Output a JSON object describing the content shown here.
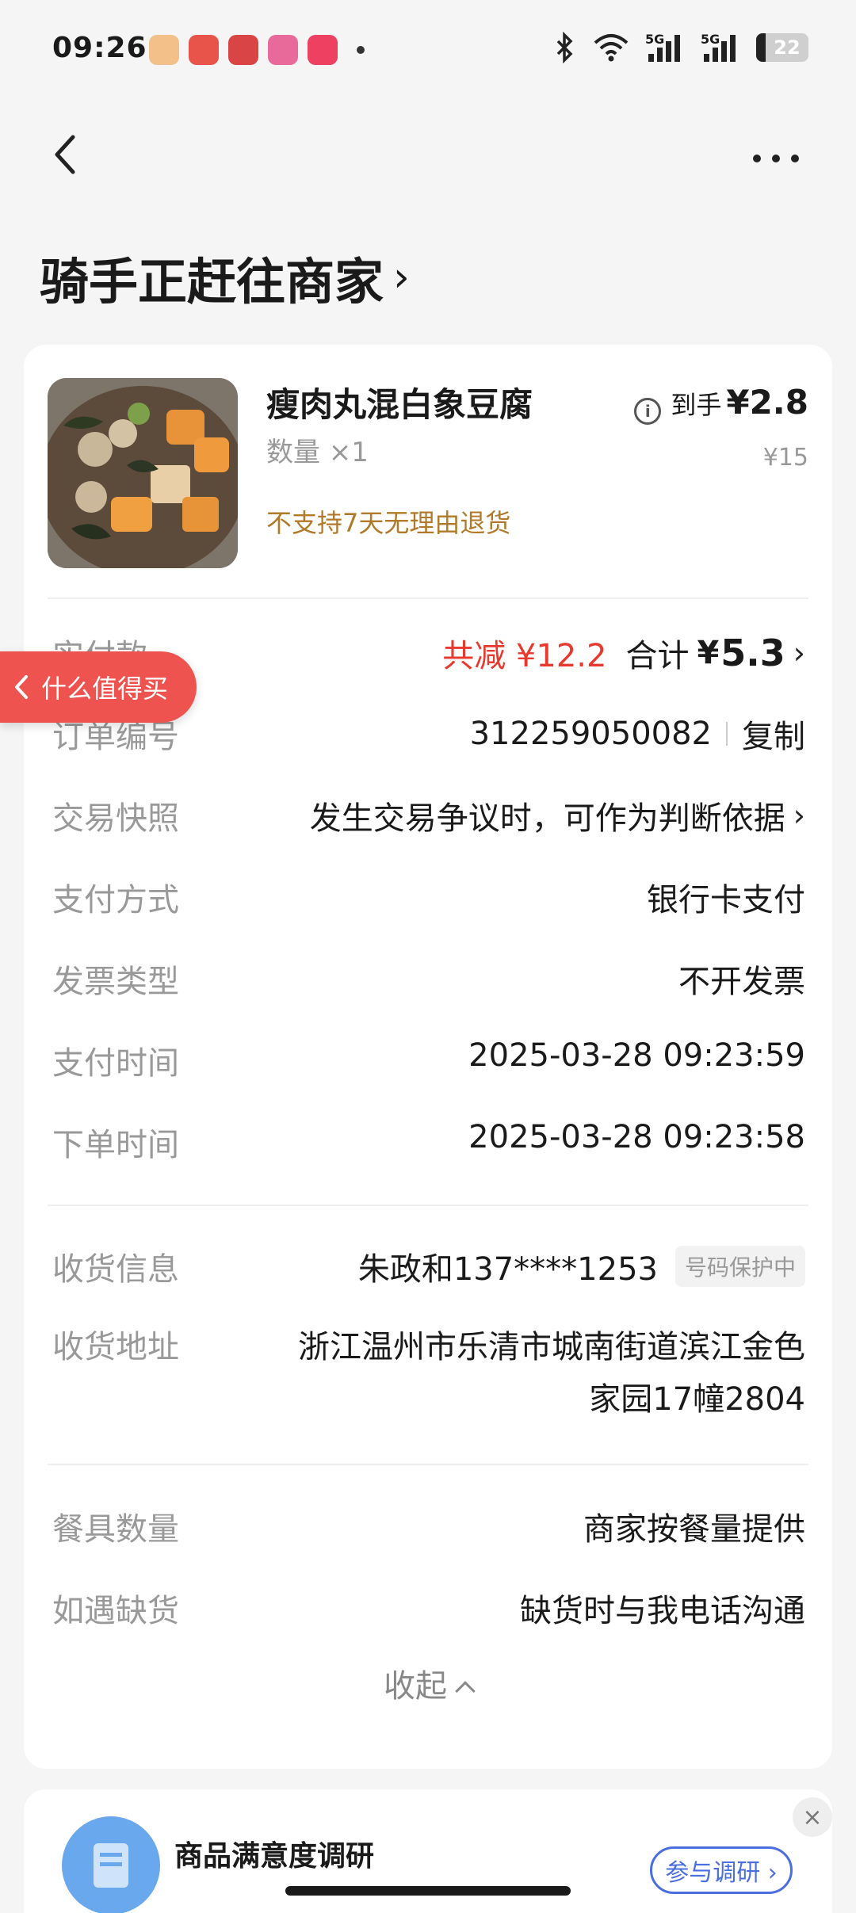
{
  "status_bar": {
    "time": "09:26",
    "battery": "22",
    "signal_1": "5G",
    "signal_2": "5G"
  },
  "header": {
    "title": "骑手正赶往商家",
    "title_chevron": "›"
  },
  "product": {
    "name": "瘦肉丸混白象豆腐",
    "quantity": "数量 ×1",
    "note": "不支持7天无理由退货",
    "net_label": "到手",
    "net_price": "¥2.8",
    "original_price": "¥15"
  },
  "float_tab": {
    "label": "什么值得买"
  },
  "rows": {
    "paid": {
      "label": "实付款",
      "discount": "共减 ¥12.2",
      "total_label": "合计",
      "total_currency": "¥",
      "total_value": "5.3"
    },
    "order_no": {
      "label": "订单编号",
      "value": "312259050082",
      "action": "复制"
    },
    "snapshot": {
      "label": "交易快照",
      "value": "发生交易争议时，可作为判断依据"
    },
    "pay_method": {
      "label": "支付方式",
      "value": "银行卡支付"
    },
    "invoice": {
      "label": "发票类型",
      "value": "不开发票"
    },
    "pay_time": {
      "label": "支付时间",
      "value": "2025-03-28 09:23:59"
    },
    "order_time": {
      "label": "下单时间",
      "value": "2025-03-28 09:23:58"
    },
    "receiver": {
      "label": "收货信息",
      "value": "朱政和137****1253",
      "badge": "号码保护中"
    },
    "address": {
      "label": "收货地址",
      "line1": "浙江温州市乐清市城南街道滨江金色",
      "line2": "家园17幢2804"
    },
    "tableware": {
      "label": "餐具数量",
      "value": "商家按餐量提供"
    },
    "stockout": {
      "label": "如遇缺货",
      "value": "缺货时与我电话沟通"
    }
  },
  "collapse_label": "收起",
  "survey": {
    "title": "商品满意度调研",
    "button": "参与调研 ›",
    "close": "×"
  },
  "colors": {
    "accent_red": "#e8392f",
    "warning_brown": "#b07a2a",
    "link_blue": "#4a6ee0"
  }
}
